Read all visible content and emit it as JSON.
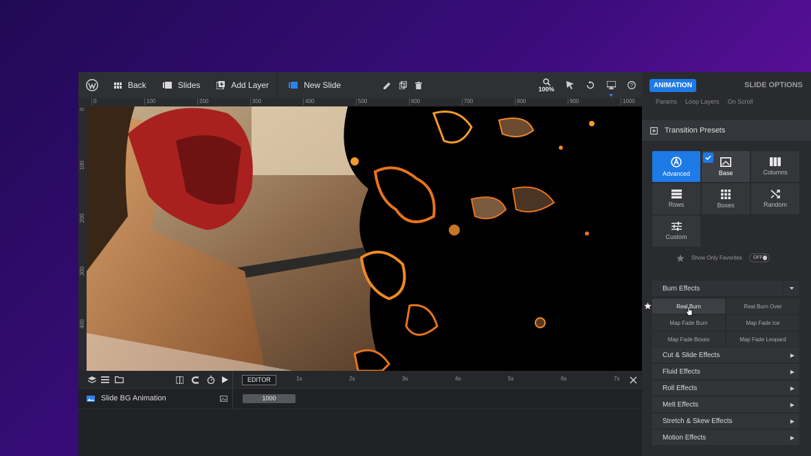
{
  "topbar": {
    "back_label": "Back",
    "slides_label": "Slides",
    "add_layer_label": "Add Layer",
    "slide_name": "New Slide",
    "zoom": "100%"
  },
  "ruler": {
    "top_ticks": [
      "0",
      "100",
      "200",
      "300",
      "400",
      "500",
      "600",
      "700",
      "800",
      "900",
      "1000"
    ],
    "left_ticks": [
      "0",
      "100",
      "200",
      "300",
      "400"
    ]
  },
  "timeline": {
    "editor_label": "EDITOR",
    "ticks": [
      "1s",
      "2s",
      "3s",
      "4s",
      "5s",
      "6s",
      "7s"
    ],
    "layer_name": "Slide BG Animation",
    "duration": "1000"
  },
  "panel": {
    "animation_tab": "ANIMATION",
    "slide_options_tab": "SLIDE OPTIONS",
    "subtabs": [
      "Params",
      "Loop Layers",
      "On Scroll"
    ],
    "transition_presets": "Transition Presets",
    "types": [
      "Advanced",
      "Base",
      "Columns",
      "Rows",
      "Boxes",
      "Random",
      "Custom"
    ],
    "favorites_label": "Show Only Favorites",
    "favorites_toggle": "OFF",
    "burn_header": "Burn Effects",
    "burn_presets": [
      "Real Burn",
      "Real Burn Over",
      "Map Fade Burn",
      "Map Fade Ice",
      "Map Fade Boxes",
      "Map Fade Leopard"
    ],
    "categories": [
      "Cut & Slide Effects",
      "Fluid Effects",
      "Roll Effects",
      "Melt Effects",
      "Stretch & Skew Effects",
      "Motion Effects"
    ]
  }
}
